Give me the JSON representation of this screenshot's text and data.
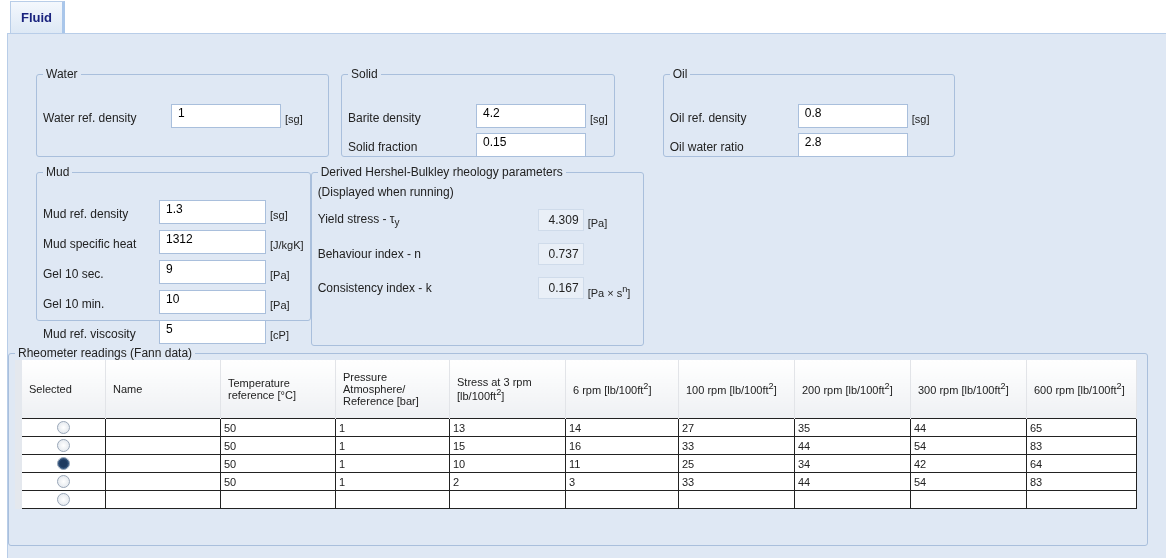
{
  "tabs": [
    {
      "label": "Fluid",
      "selected": true
    }
  ],
  "groups": [
    {
      "title": "Water",
      "fields": [
        {
          "label": "Water ref. density",
          "value": "1",
          "unit": "[sg]"
        }
      ]
    },
    {
      "title": "Solid",
      "fields": [
        {
          "label": "Barite density",
          "value": "4.2",
          "unit": "[sg]"
        },
        {
          "label": "Solid fraction",
          "value": "0.15"
        }
      ]
    },
    {
      "title": "Oil",
      "fields": [
        {
          "label": "Oil ref. density",
          "value": "0.8",
          "unit": "[sg]"
        },
        {
          "label": "Oil water ratio",
          "value": "2.8"
        }
      ]
    }
  ],
  "mud": {
    "title": "Mud",
    "fields": [
      {
        "label": "Mud ref. density",
        "value": "1.3",
        "unit": "[sg]"
      },
      {
        "label": "Mud specific heat",
        "value": "1312",
        "unit": "[J/kgK]"
      },
      {
        "label": "Gel 10 sec.",
        "value": "9",
        "unit": "[Pa]"
      },
      {
        "label": "Gel 10 min.",
        "value": "10",
        "unit": "[Pa]"
      },
      {
        "label": "Mud ref. viscosity",
        "value": "5",
        "unit": "[cP]"
      }
    ]
  },
  "derived": {
    "title": "Derived Hershel-Bulkley rheology parameters",
    "note": "(Displayed when running)",
    "params": [
      {
        "label": "Yield stress -  τ$_{y}$",
        "value": "4.309",
        "unit": "[Pa]"
      },
      {
        "label": "Behaviour index - n",
        "value": "0.737"
      },
      {
        "label": "Consistency index - k",
        "value": "0.167",
        "unit": "[Pa × s$^{n}$]"
      }
    ]
  },
  "rheometer": {
    "title": "Rheometer readings (Fann data)",
    "columns": [
      "Selected",
      "Name",
      "Temperature reference [°C]",
      "Pressure Atmosphere/ Reference [bar]",
      "Stress at 3 rpm [lb/100ft$^{2}$]",
      "6 rpm [lb/100ft$^{2}$]",
      "100 rpm [lb/100ft$^{2}$]",
      "200 rpm [lb/100ft$^{2}$]",
      "300 rpm [lb/100ft$^{2}$]",
      "600 rpm [lb/100ft$^{2}$]"
    ],
    "rows": [
      {
        "selected": false,
        "cells": [
          "50",
          "1",
          "13",
          "14",
          "27",
          "35",
          "44",
          "65"
        ]
      },
      {
        "selected": false,
        "cells": [
          "50",
          "1",
          "15",
          "16",
          "33",
          "44",
          "54",
          "83"
        ]
      },
      {
        "selected": true,
        "cells": [
          "50",
          "1",
          "10",
          "11",
          "25",
          "34",
          "42",
          "64"
        ]
      },
      {
        "selected": false,
        "cells": [
          "50",
          "1",
          "2",
          "3",
          "33",
          "44",
          "54",
          "83"
        ]
      },
      {
        "selected": false
      }
    ]
  }
}
